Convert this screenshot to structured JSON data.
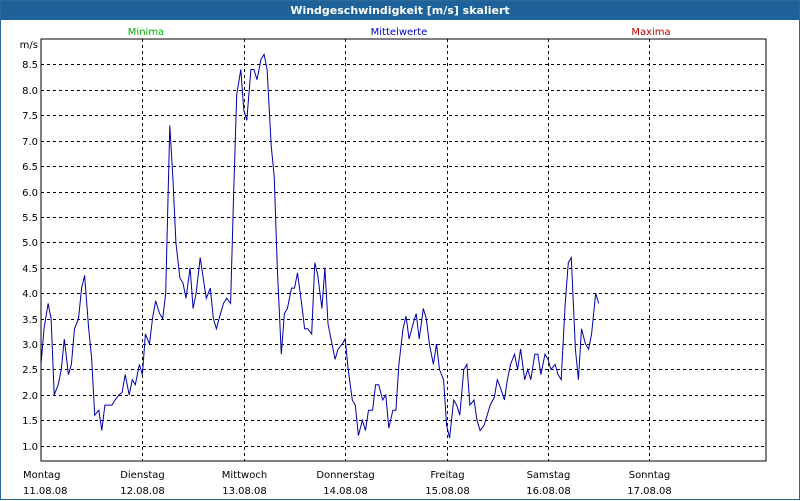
{
  "window": {
    "title": "Windgeschwindigkeit [m/s] skaliert"
  },
  "colors": {
    "title_bg": "#1e6299",
    "minima": "#00b000",
    "mittel": "#0000c8",
    "maxima": "#c00000",
    "grid": "#000000",
    "line": "#0000aa"
  },
  "chart_data": {
    "type": "line",
    "title": "Windgeschwindigkeit [m/s] skaliert",
    "ylabel": "m/s",
    "ylim": [
      0.7,
      9.0
    ],
    "yticks": [
      1.0,
      1.5,
      2.0,
      2.5,
      3.0,
      3.5,
      4.0,
      4.5,
      5.0,
      5.5,
      6.0,
      6.5,
      7.0,
      7.5,
      8.0,
      8.5
    ],
    "ytick_labels": [
      "1.0",
      "1.5",
      "2.0",
      "2.5",
      "3.0",
      "3.5",
      "4.0",
      "4.5",
      "5.0",
      "5.5",
      "6.0",
      "6.5",
      "7.0",
      "7.5",
      "8.0",
      "8.5"
    ],
    "xlim": [
      0,
      7.15
    ],
    "xticks": [
      {
        "x": 0,
        "day": "Montag",
        "date": "11.08.08"
      },
      {
        "x": 1,
        "day": "Dienstag",
        "date": "12.08.08"
      },
      {
        "x": 2,
        "day": "Mittwoch",
        "date": "13.08.08"
      },
      {
        "x": 3,
        "day": "Donnerstag",
        "date": "14.08.08"
      },
      {
        "x": 4,
        "day": "Freitag",
        "date": "15.08.08"
      },
      {
        "x": 5,
        "day": "Samstag",
        "date": "16.08.08"
      },
      {
        "x": 6,
        "day": "Sonntag",
        "date": "17.08.08"
      }
    ],
    "legend": [
      {
        "name": "Minima",
        "color": "#00b000"
      },
      {
        "name": "Mittelwerte",
        "color": "#0000c8"
      },
      {
        "name": "Maxima",
        "color": "#c00000"
      }
    ],
    "grid": true,
    "series": [
      {
        "name": "Mittelwerte",
        "points": [
          [
            0.0,
            2.6
          ],
          [
            0.03,
            3.3
          ],
          [
            0.07,
            3.8
          ],
          [
            0.1,
            3.5
          ],
          [
            0.13,
            2.0
          ],
          [
            0.17,
            2.2
          ],
          [
            0.2,
            2.5
          ],
          [
            0.23,
            3.1
          ],
          [
            0.27,
            2.4
          ],
          [
            0.3,
            2.6
          ],
          [
            0.33,
            3.3
          ],
          [
            0.37,
            3.5
          ],
          [
            0.4,
            4.1
          ],
          [
            0.43,
            4.35
          ],
          [
            0.47,
            3.3
          ],
          [
            0.5,
            2.7
          ],
          [
            0.53,
            1.6
          ],
          [
            0.57,
            1.7
          ],
          [
            0.6,
            1.3
          ],
          [
            0.63,
            1.8
          ],
          [
            0.67,
            1.8
          ],
          [
            0.7,
            1.8
          ],
          [
            0.73,
            1.9
          ],
          [
            0.77,
            2.0
          ],
          [
            0.8,
            2.05
          ],
          [
            0.83,
            2.4
          ],
          [
            0.87,
            2.0
          ],
          [
            0.9,
            2.3
          ],
          [
            0.93,
            2.2
          ],
          [
            0.97,
            2.6
          ],
          [
            1.0,
            2.4
          ],
          [
            1.03,
            3.2
          ],
          [
            1.07,
            3.0
          ],
          [
            1.1,
            3.5
          ],
          [
            1.13,
            3.85
          ],
          [
            1.17,
            3.6
          ],
          [
            1.2,
            3.5
          ],
          [
            1.23,
            4.0
          ],
          [
            1.27,
            7.3
          ],
          [
            1.3,
            6.3
          ],
          [
            1.33,
            5.0
          ],
          [
            1.37,
            4.3
          ],
          [
            1.4,
            4.2
          ],
          [
            1.43,
            3.9
          ],
          [
            1.47,
            4.5
          ],
          [
            1.5,
            3.7
          ],
          [
            1.53,
            4.0
          ],
          [
            1.57,
            4.7
          ],
          [
            1.6,
            4.3
          ],
          [
            1.63,
            3.9
          ],
          [
            1.67,
            4.1
          ],
          [
            1.7,
            3.5
          ],
          [
            1.73,
            3.3
          ],
          [
            1.77,
            3.6
          ],
          [
            1.8,
            3.8
          ],
          [
            1.83,
            3.9
          ],
          [
            1.87,
            3.8
          ],
          [
            1.9,
            6.0
          ],
          [
            1.93,
            7.9
          ],
          [
            1.97,
            8.4
          ],
          [
            2.0,
            7.6
          ],
          [
            2.03,
            7.4
          ],
          [
            2.07,
            8.4
          ],
          [
            2.1,
            8.4
          ],
          [
            2.13,
            8.2
          ],
          [
            2.17,
            8.6
          ],
          [
            2.2,
            8.7
          ],
          [
            2.23,
            8.4
          ],
          [
            2.27,
            6.9
          ],
          [
            2.3,
            6.3
          ],
          [
            2.33,
            4.5
          ],
          [
            2.37,
            2.8
          ],
          [
            2.4,
            3.6
          ],
          [
            2.43,
            3.7
          ],
          [
            2.47,
            4.1
          ],
          [
            2.5,
            4.1
          ],
          [
            2.53,
            4.4
          ],
          [
            2.57,
            3.8
          ],
          [
            2.6,
            3.3
          ],
          [
            2.63,
            3.3
          ],
          [
            2.67,
            3.2
          ],
          [
            2.7,
            4.6
          ],
          [
            2.73,
            4.35
          ],
          [
            2.77,
            3.7
          ],
          [
            2.8,
            4.5
          ],
          [
            2.83,
            3.4
          ],
          [
            2.87,
            3.0
          ],
          [
            2.9,
            2.7
          ],
          [
            2.93,
            2.9
          ],
          [
            2.97,
            3.0
          ],
          [
            3.0,
            3.1
          ],
          [
            3.03,
            2.5
          ],
          [
            3.07,
            1.9
          ],
          [
            3.1,
            1.8
          ],
          [
            3.13,
            1.2
          ],
          [
            3.17,
            1.5
          ],
          [
            3.2,
            1.3
          ],
          [
            3.23,
            1.7
          ],
          [
            3.27,
            1.7
          ],
          [
            3.3,
            2.2
          ],
          [
            3.33,
            2.2
          ],
          [
            3.37,
            1.9
          ],
          [
            3.4,
            2.0
          ],
          [
            3.43,
            1.35
          ],
          [
            3.47,
            1.7
          ],
          [
            3.5,
            1.7
          ],
          [
            3.53,
            2.6
          ],
          [
            3.57,
            3.3
          ],
          [
            3.6,
            3.55
          ],
          [
            3.63,
            3.1
          ],
          [
            3.67,
            3.4
          ],
          [
            3.7,
            3.6
          ],
          [
            3.73,
            3.1
          ],
          [
            3.77,
            3.7
          ],
          [
            3.8,
            3.5
          ],
          [
            3.83,
            3.0
          ],
          [
            3.87,
            2.6
          ],
          [
            3.9,
            3.0
          ],
          [
            3.93,
            2.5
          ],
          [
            3.97,
            2.3
          ],
          [
            4.0,
            1.4
          ],
          [
            4.03,
            1.15
          ],
          [
            4.07,
            1.9
          ],
          [
            4.1,
            1.8
          ],
          [
            4.13,
            1.6
          ],
          [
            4.17,
            2.5
          ],
          [
            4.2,
            2.6
          ],
          [
            4.23,
            1.8
          ],
          [
            4.27,
            1.9
          ],
          [
            4.3,
            1.5
          ],
          [
            4.33,
            1.3
          ],
          [
            4.37,
            1.4
          ],
          [
            4.4,
            1.6
          ],
          [
            4.43,
            1.8
          ],
          [
            4.47,
            1.95
          ],
          [
            4.5,
            2.3
          ],
          [
            4.53,
            2.15
          ],
          [
            4.57,
            1.9
          ],
          [
            4.6,
            2.3
          ],
          [
            4.63,
            2.6
          ],
          [
            4.67,
            2.8
          ],
          [
            4.7,
            2.5
          ],
          [
            4.73,
            2.9
          ],
          [
            4.77,
            2.3
          ],
          [
            4.8,
            2.5
          ],
          [
            4.83,
            2.3
          ],
          [
            4.87,
            2.8
          ],
          [
            4.9,
            2.8
          ],
          [
            4.93,
            2.4
          ],
          [
            4.97,
            2.8
          ],
          [
            5.0,
            2.7
          ],
          [
            5.03,
            2.5
          ],
          [
            5.07,
            2.6
          ],
          [
            5.1,
            2.4
          ],
          [
            5.13,
            2.3
          ],
          [
            5.17,
            3.8
          ],
          [
            5.2,
            4.6
          ],
          [
            5.23,
            4.7
          ],
          [
            5.27,
            2.9
          ],
          [
            5.3,
            2.3
          ],
          [
            5.33,
            3.3
          ],
          [
            5.37,
            3.0
          ],
          [
            5.4,
            2.9
          ],
          [
            5.43,
            3.2
          ],
          [
            5.47,
            4.0
          ],
          [
            5.5,
            3.8
          ]
        ]
      }
    ]
  }
}
